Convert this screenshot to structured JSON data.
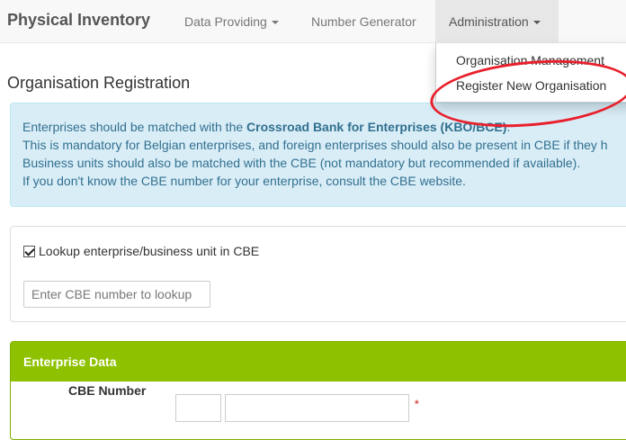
{
  "navbar": {
    "brand": "Physical Inventory",
    "items": [
      {
        "label": "Data Providing",
        "has_caret": true
      },
      {
        "label": "Number Generator",
        "has_caret": false
      },
      {
        "label": "Administration",
        "has_caret": true,
        "active": true
      }
    ]
  },
  "dropdown": {
    "items": [
      {
        "label": "Organisation Management"
      },
      {
        "label": "Register New Organisation",
        "highlighted_by_annotation": true
      }
    ],
    "annotation_color": "#e8202c"
  },
  "page": {
    "title": "Organisation Registration"
  },
  "alert": {
    "line1_prefix": "Enterprises should be matched with the ",
    "line1_bold": "Crossroad Bank for Enterprises (KBO/BCE)",
    "line1_suffix": ".",
    "line2": "This is mandatory for Belgian enterprises, and foreign enterprises should also be present in CBE if they h",
    "line3": "Business units should also be matched with the CBE (not mandatory but recommended if available).",
    "line4_prefix": "If you don't know the CBE number for your enterprise, ",
    "line4_link": "consult the CBE website",
    "line4_suffix": ".",
    "color": "#31708f",
    "background": "#d9edf7"
  },
  "lookup": {
    "checkbox_label": "Lookup enterprise/business unit in CBE",
    "checked": true,
    "input_placeholder": "Enter CBE number to lookup",
    "input_value": ""
  },
  "enterprise": {
    "heading": "Enterprise Data",
    "heading_color": "#8ec100",
    "cbe_label": "CBE Number",
    "cbe_part1_value": "",
    "cbe_part2_value": "",
    "required_mark": "*"
  }
}
